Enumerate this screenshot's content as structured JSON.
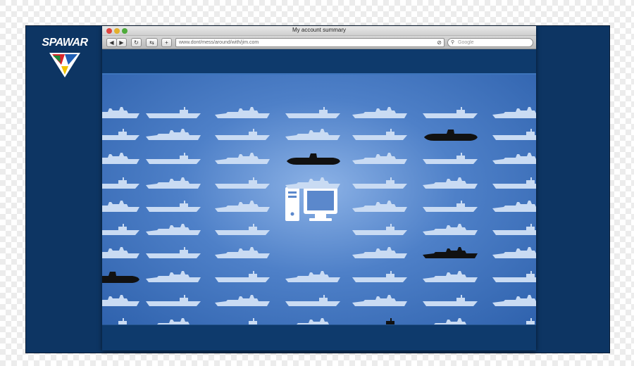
{
  "brand": {
    "logo_text": "SPAWAR"
  },
  "browser": {
    "window_title": "My account summary",
    "toolbar": {
      "back": "◀",
      "forward": "▶",
      "reload": "↻",
      "bookmarks": "⇆",
      "add": "+"
    },
    "address": "www.dont/mess/around/with/jim.com",
    "search_placeholder": "Google"
  },
  "content": {
    "center_icon": "computer-icon",
    "ship_types": [
      "destroyer",
      "carrier",
      "submarine"
    ],
    "colors": {
      "background": "#4e80c8",
      "ship_light": "#c9dbf3",
      "ship_dark": "#111111",
      "chrome": "#0e3a6c"
    }
  }
}
